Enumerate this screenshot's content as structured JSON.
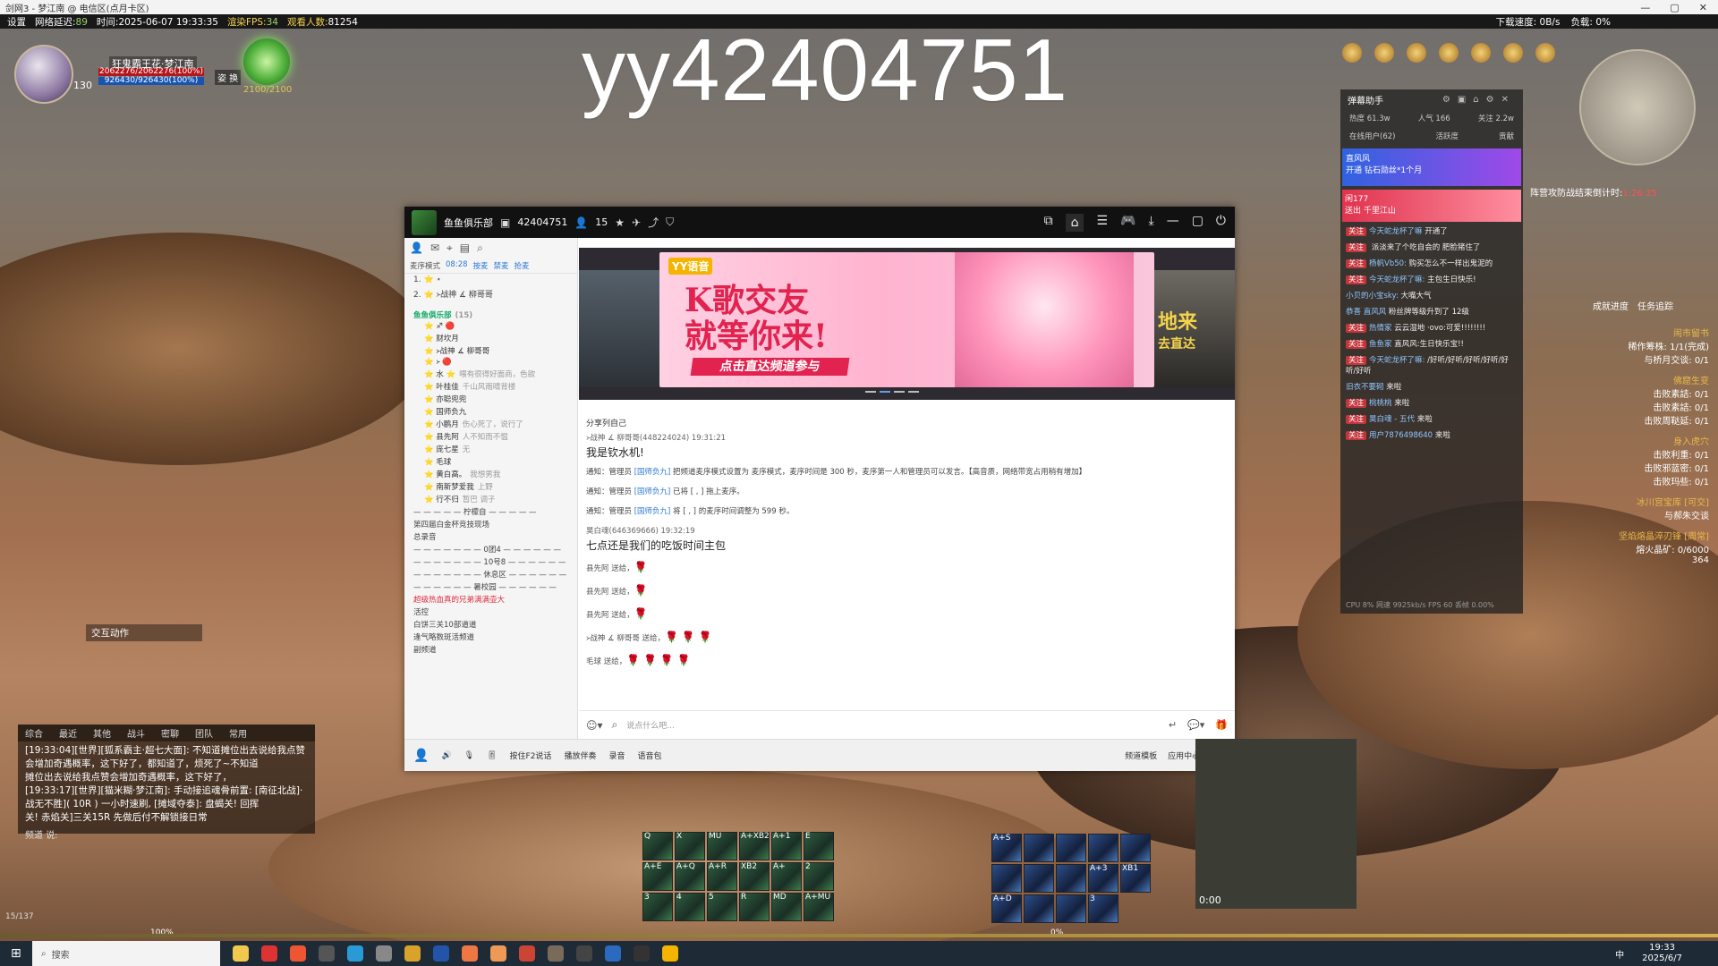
{
  "window_title": "剑网3 - 梦江南 @ 电信区(点月卡区)",
  "gamebar": {
    "settings": "设置",
    "latency_label": "网络延迟:",
    "latency": "89",
    "time_label": "时间:",
    "time": "2025-06-07 19:33:35",
    "fps_label": "渲染FPS:",
    "fps": "34",
    "player_count_label": "观看人数:",
    "player_count": "81254",
    "download_label": "下载速度:",
    "download": "0B/s",
    "load_label": "负载:",
    "load": "0%"
  },
  "watermark": "yy42404751",
  "player": {
    "name": "狂鬼霸王花·梦江南",
    "hp": "2062276/2062276(100%)",
    "mp": "926430/926430(100%)",
    "level": "130",
    "stance": "姿 换",
    "energy": "2100/2100"
  },
  "yy": {
    "channel_name": "鱼鱼俱乐部",
    "channel_id": "42404751",
    "online": "15",
    "mode": "麦序模式",
    "timer": "08:28",
    "mode_actions": [
      "按麦",
      "禁麦",
      "抢麦"
    ],
    "queue": [
      {
        "no": "1.",
        "name": "⭐ ⋆"
      },
      {
        "no": "2.",
        "name": "⭐ ᚛战神 ∡ 柳哥哥"
      }
    ],
    "room_title": "鱼鱼俱乐部",
    "room_count": "(15)",
    "members": [
      {
        "name": "⭐ ♐ 🔴",
        "note": ""
      },
      {
        "name": "⭐ 财坎月",
        "note": ""
      },
      {
        "name": "⭐ ᚛战神 ∡ 柳哥哥",
        "note": ""
      },
      {
        "name": "⭐ ᚛ 🔴",
        "note": ""
      },
      {
        "name": "⭐ 水 ⭐",
        "note": "喂有很得好面商，色欲"
      },
      {
        "name": "⭐ 叶桂佳",
        "note": "千山风雨晴背楼"
      },
      {
        "name": "⭐ 亦聪兜兜",
        "note": ""
      },
      {
        "name": "⭐ 国师负九",
        "note": ""
      },
      {
        "name": "⭐ 小鹏月",
        "note": "伤心死了，说行了"
      },
      {
        "name": "⭐ 县先阿",
        "note": "人不知而不愠"
      },
      {
        "name": "⭐ 庞七星",
        "note": "无"
      },
      {
        "name": "⭐ 毛球",
        "note": ""
      },
      {
        "name": "⭐ 黄白高。",
        "note": "我想男我"
      },
      {
        "name": "⭐ 南新梦爱我",
        "note": "上野"
      },
      {
        "name": "⭐ 行不归",
        "note": "暂巴 调子"
      }
    ],
    "channels": [
      "— — — — — 柠檬自 — — — — —",
      "第四届白金杯竞技现场",
      "总录音",
      "— — — — — — — 0团4 — — — — — —",
      "— — — — — — — 10号8 — — — — — —",
      "— — — — — — — 休息区 — — — — — —",
      "— — — — — — 暑校园 — — — — — —"
    ],
    "hot_channel": "超级热血真的兄弟满满壶大",
    "channels2": [
      "活控",
      "白饼三关10部道道",
      "逢气略数斑活频道",
      "副频道"
    ],
    "banner": {
      "logo": "YY语音",
      "title_line1": "K歌交友",
      "title_line2": "就等你来!",
      "button": "点击直达频道参与",
      "right_text": "地来",
      "right_sub": "去直达",
      "right_logo": "YY语音"
    },
    "chat_header": "分享列自己",
    "chat": [
      {
        "kind": "msg",
        "who": "᚛战神 ∡ 柳哥哥(448224024)  19:31:21",
        "text": "我是钦水机!"
      },
      {
        "kind": "note",
        "text_a": "通知：管理员 ",
        "admin": "[国师负九]",
        "text_b": " 把频道麦序模式设置为 麦序模式，麦序时间是 300 秒，麦序第一人和管理员可以发言。【高音质，网络带宽占用稍有增加】"
      },
      {
        "kind": "note",
        "text_a": "通知：管理员 ",
        "admin": "[国师负九]",
        "text_b": " 已将 [ , ] 拖上麦序。"
      },
      {
        "kind": "note",
        "text_a": "通知：管理员 ",
        "admin": "[国师负九]",
        "text_b": " 将 [ , ] 的麦序时间调整为 599 秒。"
      },
      {
        "kind": "msg",
        "who": "昊白魂(646369666)  19:32:19",
        "text": "七点还是我们的吃饭时间主包"
      }
    ],
    "gifts": [
      {
        "from": "县先阿 送给，",
        "items": "🌹"
      },
      {
        "from": "县先阿 送给，",
        "items": "🌹"
      },
      {
        "from": "县先阿 送给，",
        "items": "🌹"
      },
      {
        "from": "᚛战神 ∡ 柳哥哥 送给，",
        "items": "🌹 🌹 🌹"
      },
      {
        "from": "毛球 送给，",
        "items": "🌹 🌹 🌹 🌹"
      }
    ],
    "input_placeholder": "说点什么吧...",
    "bottom": [
      "按住F2说话",
      "播放伴奏",
      "录音",
      "语音包"
    ],
    "bottom_right": [
      "频道模板",
      "应用中心"
    ]
  },
  "danmu": {
    "title": "弹幕助手",
    "stats": [
      "热度 61.3w",
      "人气 166",
      "关注 2.2w"
    ],
    "stats2": [
      "在线用户(62)",
      "活跃度",
      "贡献"
    ],
    "promo": "开通 钻石勋丝*1个月",
    "promo_name": "直风风",
    "promo2_name": "闲177",
    "promo2_sub": "送出 千里江山",
    "rows": [
      {
        "tag": "关注",
        "name": "今天蛇龙杯了嘛",
        "text": "开通了"
      },
      {
        "tag": "关注",
        "name": "",
        "text": "派淡来了个吃自会的 肥脸猪住了"
      },
      {
        "tag": "关注",
        "name": "杨帆Vb50:",
        "text": "购买怎么不一样出鬼泥的"
      },
      {
        "tag": "关注",
        "name": "今天蛇龙杯了嘛:",
        "text": "主包生日快乐!"
      },
      {
        "tag": "",
        "name": "小贝的小宝sky:",
        "text": "大嘴大气"
      },
      {
        "tag": "",
        "name": "恭喜 直风风",
        "text": "粉丝牌等级升到了 12级"
      },
      {
        "tag": "关注",
        "name": "热情家",
        "text": "云云湿地 ·ovo:可爱!!!!!!!!"
      },
      {
        "tag": "关注",
        "name": "鱼鱼家",
        "text": "直风风:生日快乐宝!!"
      },
      {
        "tag": "关注",
        "name": "今天蛇龙杯了嘛:",
        "text": "/好听/好听/好听/好听/好听/好听"
      },
      {
        "tag": "",
        "name": "旧衣不要砌",
        "text": "来啦"
      },
      {
        "tag": "关注",
        "name": "桃桃桃",
        "text": "来啦"
      },
      {
        "tag": "关注",
        "name": "昊白魂 - 五代",
        "text": "来啦"
      },
      {
        "tag": "关注",
        "name": "用户7876498640",
        "text": "来啦"
      }
    ],
    "footer": "CPU 8%  网速 9925kb/s  FPS 60    丢帧 0.00%"
  },
  "countdown": {
    "label": "阵营攻防战结束倒计时:",
    "value": "1:26:25"
  },
  "tasks": {
    "tabs": [
      "成就进度",
      "任务追踪"
    ],
    "items": [
      {
        "h": "闹市留书",
        "lines": [
          "稀作筹株: 1/1(完成)",
          "与桥月交谈: 0/1"
        ]
      },
      {
        "h": "佛窟生变",
        "lines": [
          "击败素詰: 0/1",
          "击败素詰: 0/1",
          "击败周鞑延: 0/1"
        ]
      },
      {
        "h": "身入虎穴",
        "lines": [
          "击败利重: 0/1",
          "击败邪蓝密: 0/1",
          "击败玛些: 0/1"
        ]
      },
      {
        "h": "冰川宫宝库 [可交]",
        "lines": [
          "与郝朱交谈"
        ]
      },
      {
        "h": "坚焰熔晶淬刃锋 [周常]",
        "lines": [
          "熔火晶矿: 0/6000"
        ]
      }
    ],
    "count": "364"
  },
  "chatpanel": {
    "tabs": [
      "综合",
      "最近",
      "其他",
      "战斗",
      "密聊",
      "团队",
      "常用"
    ],
    "lines": [
      "[19:33:04][世界][狐系霸主·超七大面]: 不知道摊位出去说给我点赞会增加奇遇概率，这下好了，都知道了，烦死了~不知道",
      "摊位出去说给我点赞会增加奇遇概率，这下好了，",
      "[19:33:17][世界][猫米糊·梦江南]: 手动接追魂骨前置: [南征北战]·战无不胜]( 10R ) 一小时速刷, [摊域夺泰]: 盘蝎关! 回挥",
      "关!  赤焰关]三关15R 先做后付不解锁接日常"
    ],
    "channel": "频道",
    "say": "说:"
  },
  "interact_label": "交互动作",
  "skills_left": [
    "Q",
    "X",
    "MU",
    "A+XB2",
    "A+1",
    "E",
    "A+E",
    "A+Q",
    "A+R",
    "XB2",
    "A+",
    "2",
    "3",
    "4",
    "5",
    "R",
    "MD",
    "A+MU"
  ],
  "skills_right": [
    "A+S",
    "",
    "",
    "",
    "",
    "",
    "",
    "",
    "A+3",
    "XB1",
    "A+D",
    "",
    "",
    "3"
  ],
  "exp": {
    "left": "100%",
    "right": "0%"
  },
  "position": "15/137",
  "video": {
    "time": "0:00"
  },
  "taskbar": {
    "search": "搜索",
    "ime": "中",
    "time": "19:33",
    "date": "2025/6/7"
  }
}
